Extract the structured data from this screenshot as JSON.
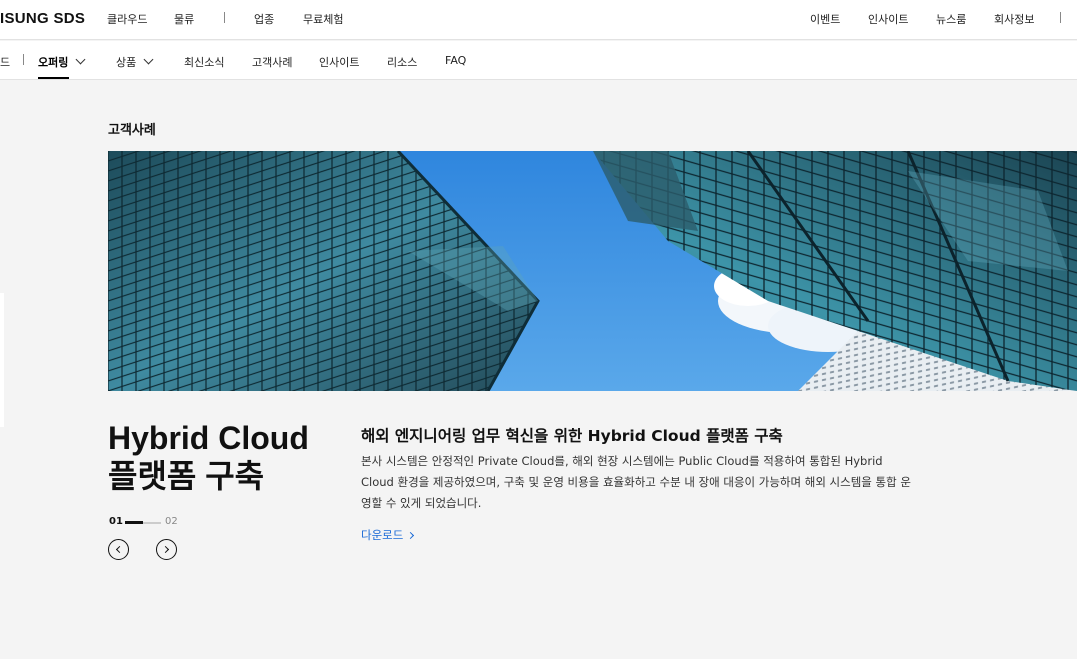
{
  "header": {
    "logo": "ISUNG SDS",
    "left_nav": [
      "클라우드",
      "물류",
      "업종",
      "무료체험"
    ],
    "right_nav": [
      "이벤트",
      "인사이트",
      "뉴스룸",
      "회사정보"
    ]
  },
  "subnav": {
    "partial_label": "드",
    "items": [
      "오퍼링",
      "상품",
      "최신소식",
      "고객사례",
      "인사이트",
      "리소스",
      "FAQ"
    ],
    "active": "오퍼링"
  },
  "section": {
    "title": "고객사례"
  },
  "case": {
    "title_line1": "Hybrid Cloud",
    "title_line2": "플랫폼 구축",
    "headline": "해외 엔지니어링 업무 혁신을 위한 Hybrid Cloud 플랫폼 구축",
    "description": "본사 시스템은 안정적인 Private Cloud를, 해외 현장 시스템에는 Public Cloud를 적용하여 통합된 Hybrid Cloud 환경을 제공하였으며, 구축 및 운영 비용을 효율화하고 수분 내 장애 대응이 가능하며 해외 시스템을 통합 운영할 수 있게 되었습니다.",
    "download_label": "다운로드"
  },
  "pager": {
    "current": "01",
    "total": "02",
    "progress": 0.5
  },
  "colors": {
    "accent_link": "#1a6ad6",
    "sky": "#3a8fe0",
    "glass": "#3f8aa0"
  },
  "icons": {
    "subnav_dropdown": "chevron-down-icon",
    "prev": "chevron-left-icon",
    "next": "chevron-right-icon",
    "download": "chevron-right-icon"
  }
}
